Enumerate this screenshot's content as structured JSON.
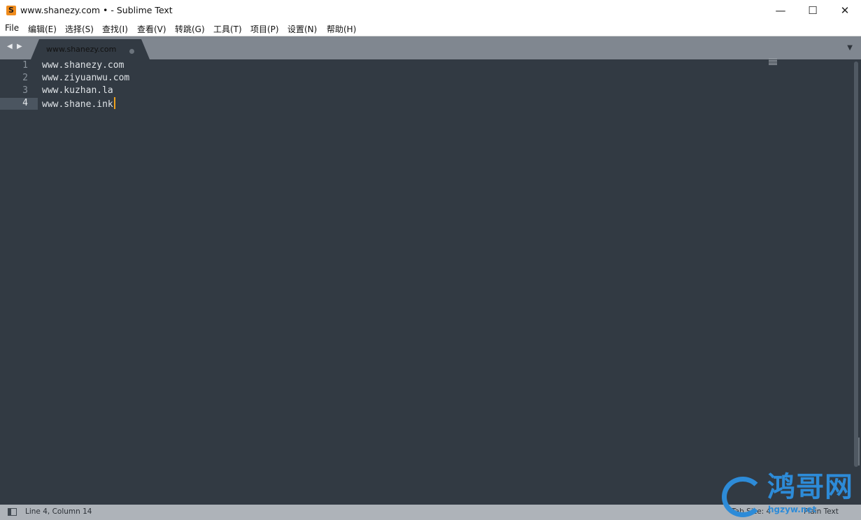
{
  "window": {
    "app_icon_glyph": "S",
    "title": "www.shanezy.com • - Sublime Text",
    "controls": {
      "minimize": "—",
      "maximize": "☐",
      "close": "✕"
    }
  },
  "menu": [
    {
      "label": "File"
    },
    {
      "label": "编辑(E)"
    },
    {
      "label": "选择(S)"
    },
    {
      "label": "查找(I)"
    },
    {
      "label": "查看(V)"
    },
    {
      "label": "转跳(G)"
    },
    {
      "label": "工具(T)"
    },
    {
      "label": "项目(P)"
    },
    {
      "label": "设置(N)"
    },
    {
      "label": "帮助(H)"
    }
  ],
  "tabbar": {
    "nav_prev": "◀",
    "nav_next": "▶",
    "tab_list_icon": "▼",
    "tabs": [
      {
        "label": "www.shanezy.com",
        "dirty": true,
        "active": true
      }
    ]
  },
  "editor": {
    "line_numbers": [
      "1",
      "2",
      "3",
      "4"
    ],
    "lines": [
      "www.shanezy.com",
      "www.ziyuanwu.com",
      "www.kuzhan.la",
      "www.shane.ink"
    ],
    "current_line": 4,
    "caret_color": "#f0a21b"
  },
  "statusbar": {
    "position": "Line 4, Column 14",
    "tab_size": "Tab Size: 4",
    "syntax": "Plain Text"
  },
  "watermark": {
    "text": "鸿哥网",
    "url": "hgzyw.net"
  },
  "colors": {
    "editor_bg": "#323a43",
    "tabbar_bg": "#808790",
    "statusbar_bg": "#aeb3b9",
    "accent": "#f08c1d",
    "watermark": "#2d8bd8"
  }
}
